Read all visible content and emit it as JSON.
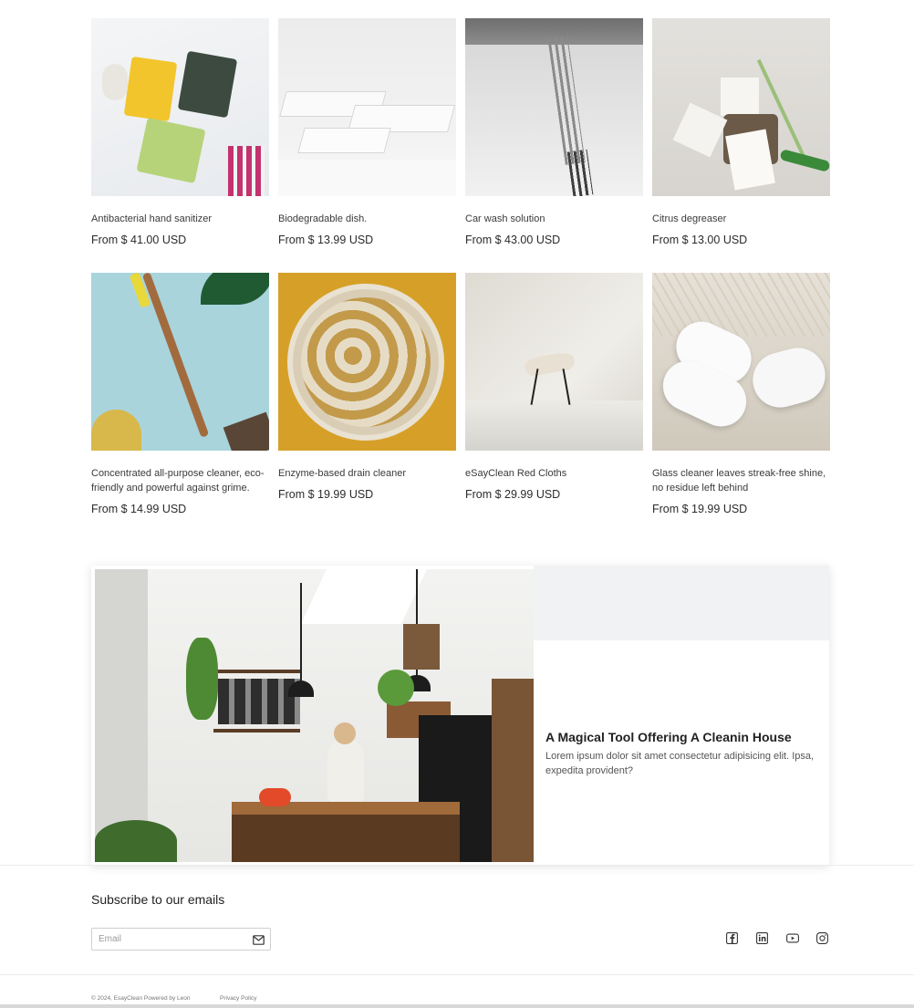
{
  "products": [
    {
      "title": "Antibacterial hand sanitizer",
      "price": "From $ 41.00 USD"
    },
    {
      "title": "Biodegradable dish.",
      "price": "From $ 13.99 USD"
    },
    {
      "title": "Car wash solution",
      "price": "From $ 43.00 USD"
    },
    {
      "title": "Citrus degreaser",
      "price": "From $ 13.00 USD"
    },
    {
      "title": "Concentrated all-purpose cleaner, eco-friendly and powerful against grime.",
      "price": "From $ 14.99 USD"
    },
    {
      "title": "Enzyme-based drain cleaner",
      "price": "From $ 19.99 USD"
    },
    {
      "title": "eSayClean Red Cloths",
      "price": "From $ 29.99 USD"
    },
    {
      "title": "Glass cleaner leaves streak-free shine, no residue left behind",
      "price": "From $ 19.99 USD"
    }
  ],
  "promo": {
    "title": "A Magical Tool Offering A Cleanin House",
    "body": "Lorem ipsum dolor sit amet consectetur adipisicing elit. Ipsa, expedita provident?"
  },
  "footer": {
    "subscribe_title": "Subscribe to our emails",
    "email_placeholder": "Email",
    "copyright": "© 2024, EsayClean Powered by Leon",
    "privacy": "Privacy Policy"
  },
  "icons": {
    "mail": "mail-icon",
    "social": [
      "facebook-icon",
      "linkedin-icon",
      "youtube-icon",
      "instagram-icon"
    ]
  }
}
